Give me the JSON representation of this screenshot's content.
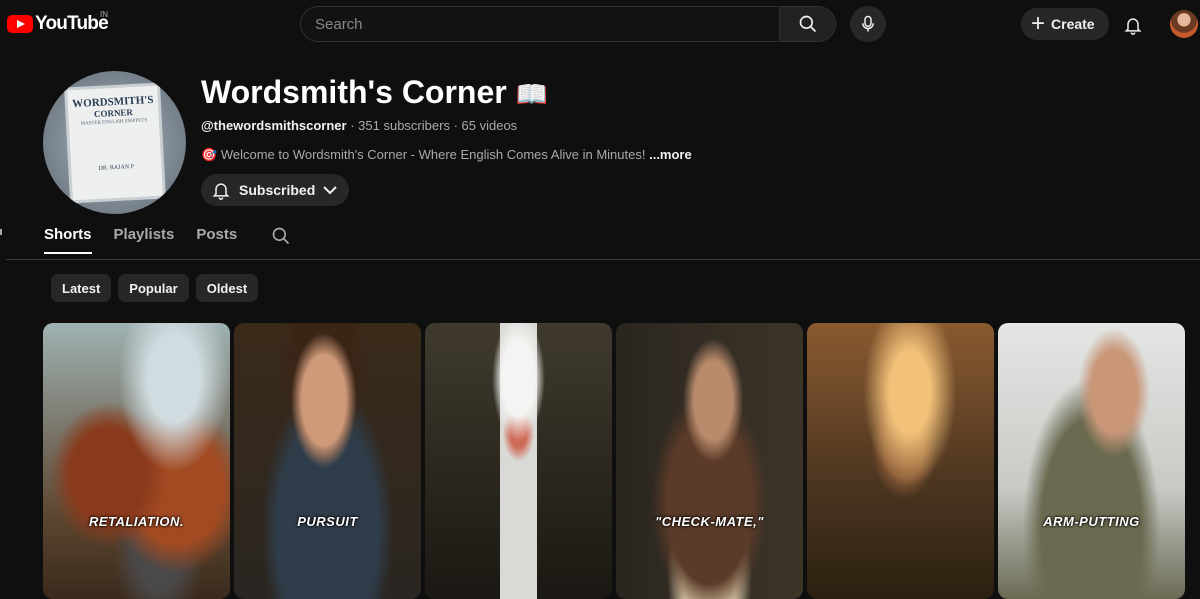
{
  "header": {
    "logo_text": "YouTube",
    "country_code": "IN",
    "search_placeholder": "Search",
    "create_label": "Create"
  },
  "channel": {
    "avatar_lines": [
      "WORDSMITH'S",
      "CORNER",
      "MASTER ENGLISH SNIPPETS",
      "DR. RAJAN P"
    ],
    "name": "Wordsmith's Corner",
    "name_emoji": "📖",
    "handle": "@thewordsmithscorner",
    "subscribers": "351 subscribers",
    "videos": "65 videos",
    "description_emoji": "🎯",
    "description": "Welcome to Wordsmith's Corner - Where English Comes Alive in Minutes!",
    "more_label": "...more",
    "subscribed_label": "Subscribed"
  },
  "tabs": [
    {
      "label": "Shorts",
      "active": true
    },
    {
      "label": "Playlists",
      "active": false
    },
    {
      "label": "Posts",
      "active": false
    }
  ],
  "filters": [
    "Latest",
    "Popular",
    "Oldest"
  ],
  "shorts": [
    {
      "caption": "RETALIATION."
    },
    {
      "caption": "PURSUIT"
    },
    {
      "caption": ""
    },
    {
      "caption": "\"CHECK-MATE,\""
    },
    {
      "caption": ""
    },
    {
      "caption": "ARM-PUTTING"
    }
  ],
  "colors": {
    "background": "#0f0f0f",
    "brand_red": "#ff0000",
    "chip_bg": "#272727"
  }
}
